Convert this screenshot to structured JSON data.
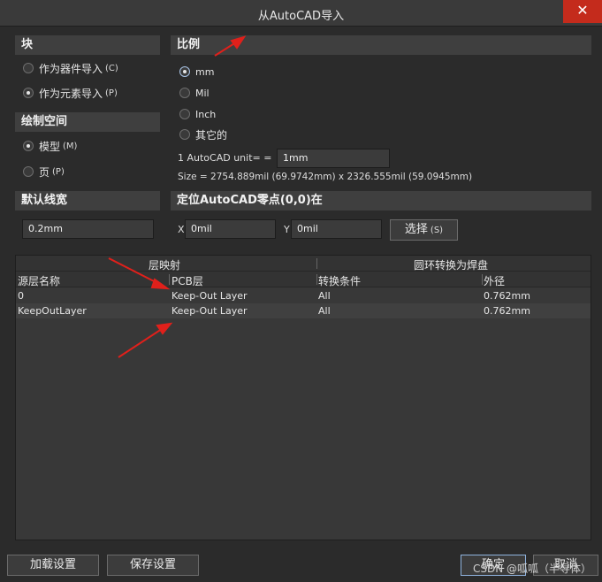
{
  "window": {
    "title": "从AutoCAD导入",
    "close_label": "✕"
  },
  "block": {
    "header": "块",
    "options": [
      {
        "label": "作为器件导入",
        "hint": "(C)",
        "checked": false
      },
      {
        "label": "作为元素导入",
        "hint": "(P)",
        "checked": true
      }
    ]
  },
  "drawing_space": {
    "header": "绘制空间",
    "options": [
      {
        "label": "模型",
        "hint": "(M)",
        "checked": true
      },
      {
        "label": "页",
        "hint": "(P)",
        "checked": false
      }
    ]
  },
  "line_width": {
    "header": "默认线宽",
    "value": "0.2mm"
  },
  "scale": {
    "header": "比例",
    "options": [
      {
        "label": "mm",
        "checked": true
      },
      {
        "label": "Mil",
        "checked": false
      },
      {
        "label": "Inch",
        "checked": false
      },
      {
        "label": "其它的",
        "checked": false
      }
    ],
    "unit_label": "1 AutoCAD unit= =",
    "unit_value": "1mm",
    "size_text": "Size = 2754.889mil (69.9742mm) x 2326.555mil (59.0945mm)"
  },
  "origin": {
    "header": "定位AutoCAD零点(0,0)在",
    "x_label": "X",
    "x_value": "0mil",
    "y_label": "Y",
    "y_value": "0mil",
    "select_label": "选择",
    "select_hint": "(S)"
  },
  "table": {
    "group_headers": [
      "层映射",
      "圆环转换为焊盘"
    ],
    "columns": [
      "源层名称",
      "PCB层",
      "转换条件",
      "外径"
    ],
    "rows": [
      [
        "0",
        "Keep-Out Layer",
        "All",
        "0.762mm"
      ],
      [
        "KeepOutLayer",
        "Keep-Out Layer",
        "All",
        "0.762mm"
      ]
    ]
  },
  "footer": {
    "load_label": "加载设置",
    "save_label": "保存设置",
    "ok_label": "确定",
    "cancel_label": "取消",
    "watermark": "CSDN @呱呱（半导体）"
  },
  "colors": {
    "arrow": "#e0201b",
    "accent_focus": "#a9c4e6",
    "close": "#c42b1c"
  }
}
